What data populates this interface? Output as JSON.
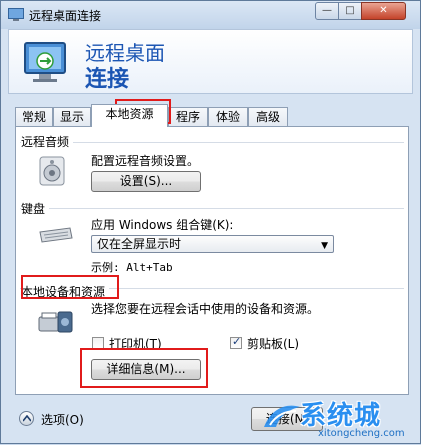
{
  "window": {
    "title": "远程桌面连接",
    "controls": {
      "minimize": "—",
      "maximize": "□",
      "close": "✕"
    }
  },
  "banner": {
    "line1": "远程桌面",
    "line2": "连接"
  },
  "tabs": [
    {
      "label": "常规"
    },
    {
      "label": "显示"
    },
    {
      "label": "本地资源",
      "active": true
    },
    {
      "label": "程序"
    },
    {
      "label": "体验"
    },
    {
      "label": "高级"
    }
  ],
  "audio": {
    "group_title": "远程音频",
    "description": "配置远程音频设置。",
    "settings_button": "设置(S)..."
  },
  "keyboard": {
    "group_title": "键盘",
    "label": "应用 Windows 组合键(K):",
    "selected": "仅在全屏显示时",
    "example": "示例: Alt+Tab"
  },
  "devices": {
    "group_title": "本地设备和资源",
    "description": "选择您要在远程会话中使用的设备和资源。",
    "printer": {
      "label": "打印机(T)",
      "checked": false
    },
    "clipboard": {
      "label": "剪贴板(L)",
      "checked": true
    },
    "details_button": "详细信息(M)..."
  },
  "footer": {
    "options_label": "选项(O)",
    "connect_button": "连接(N)"
  },
  "watermark": {
    "text": "系统城",
    "url": "xitongcheng.com"
  },
  "colors": {
    "accent": "#1b55b3",
    "highlight": "#e11b1b",
    "watermark": "#2a8ff0"
  }
}
